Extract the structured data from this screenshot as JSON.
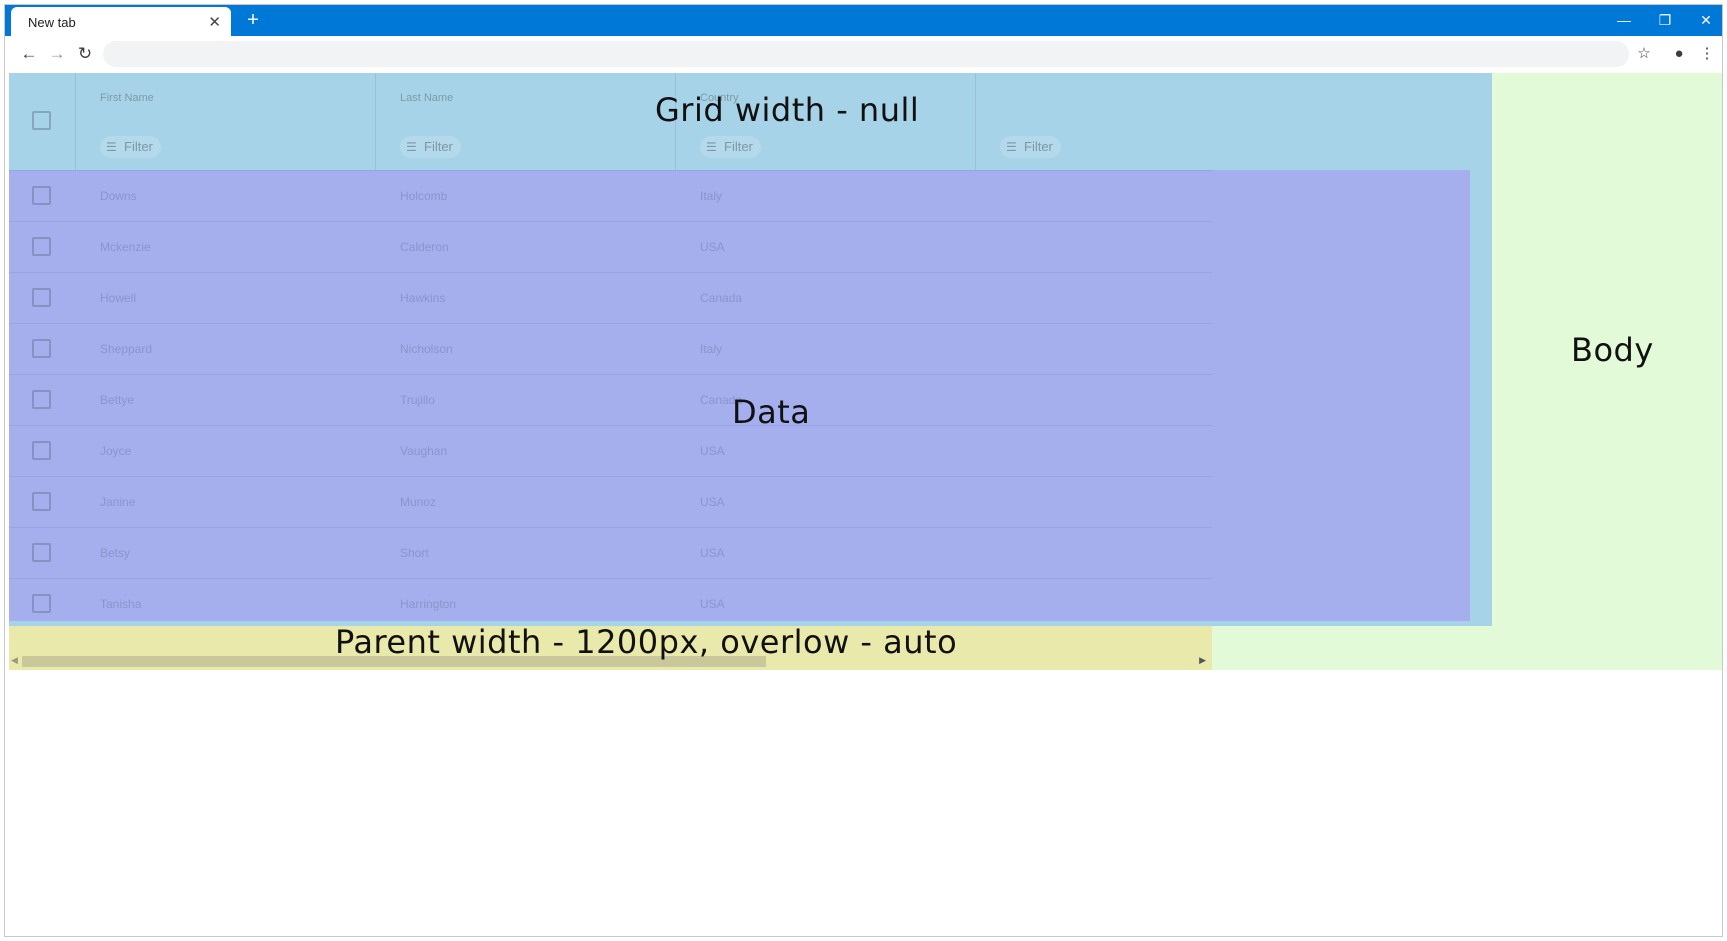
{
  "browser": {
    "tab_title": "New tab",
    "tab_close": "✕",
    "new_tab": "+",
    "window_controls": {
      "minimize": "—",
      "restore": "❐",
      "close": "✕"
    },
    "nav": {
      "back": "←",
      "forward": "→",
      "reload": "↻"
    },
    "address": "",
    "icons": {
      "bookmark": "☆",
      "profile": "●",
      "menu": "⋮"
    }
  },
  "grid": {
    "columns": [
      "First Name",
      "Last Name",
      "Country",
      ""
    ],
    "filter_label": "Filter",
    "rows": [
      {
        "first": "Downs",
        "last": "Holcomb",
        "country": "Italy"
      },
      {
        "first": "Mckenzie",
        "last": "Calderon",
        "country": "USA"
      },
      {
        "first": "Howell",
        "last": "Hawkins",
        "country": "Canada"
      },
      {
        "first": "Sheppard",
        "last": "Nicholson",
        "country": "Italy"
      },
      {
        "first": "Bettye",
        "last": "Trujillo",
        "country": "Canada"
      },
      {
        "first": "Joyce",
        "last": "Vaughan",
        "country": "USA"
      },
      {
        "first": "Janine",
        "last": "Munoz",
        "country": "USA"
      },
      {
        "first": "Betsy",
        "last": "Short",
        "country": "USA"
      },
      {
        "first": "Tanisha",
        "last": "Harrington",
        "country": "USA"
      }
    ]
  },
  "annotations": {
    "grid": "Grid width - null",
    "data": "Data",
    "body": "Body",
    "parent": "Parent width - 1200px, overlow - auto"
  },
  "colors": {
    "titlebar": "#0078d7",
    "body_region": "#e2fad8",
    "parent_region": "#e9e9ac",
    "grid_region": "#a7d3e8",
    "data_region": "#a5afee"
  }
}
